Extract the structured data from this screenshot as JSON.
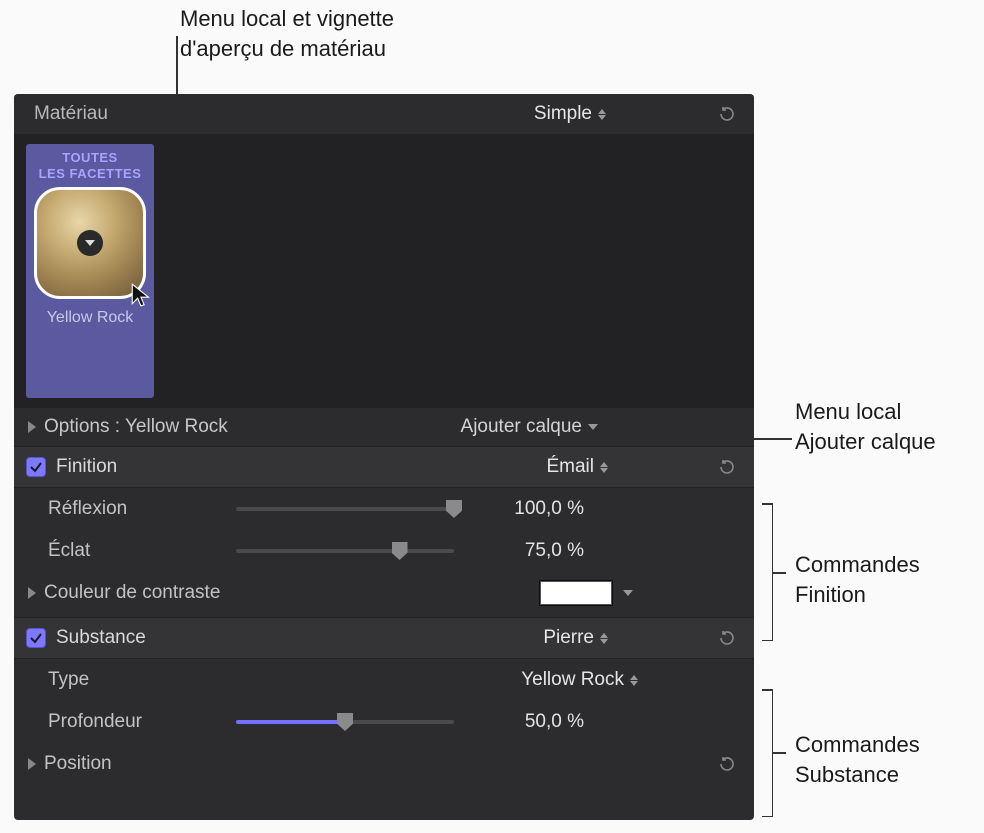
{
  "callouts": {
    "preview": "Menu local et vignette\nd'aperçu de matériau",
    "add_layer": "Menu local\nAjouter calque",
    "finition": "Commandes\nFinition",
    "substance": "Commandes\nSubstance"
  },
  "header": {
    "title": "Matériau",
    "mode": "Simple"
  },
  "thumbnail": {
    "facets_label": "TOUTES\nLES FACETTES",
    "material_name": "Yellow Rock"
  },
  "options": {
    "label_prefix": "Options :",
    "material_name": "Yellow Rock",
    "add_layer_label": "Ajouter calque"
  },
  "finition": {
    "section_label": "Finition",
    "type_value": "Émail",
    "reflection": {
      "label": "Réflexion",
      "value": 100.0,
      "display": "100,0 %"
    },
    "eclat": {
      "label": "Éclat",
      "value": 75.0,
      "display": "75,0 %"
    },
    "contrast_color": {
      "label": "Couleur de contraste",
      "hex": "#ffffff"
    }
  },
  "substance": {
    "section_label": "Substance",
    "type_value": "Pierre",
    "type_row": {
      "label": "Type",
      "value": "Yellow Rock"
    },
    "profondeur": {
      "label": "Profondeur",
      "value": 50.0,
      "display": "50,0 %"
    },
    "position": {
      "label": "Position"
    }
  },
  "colors": {
    "accent": "#7d78ff",
    "card_bg": "#5b59a0"
  }
}
